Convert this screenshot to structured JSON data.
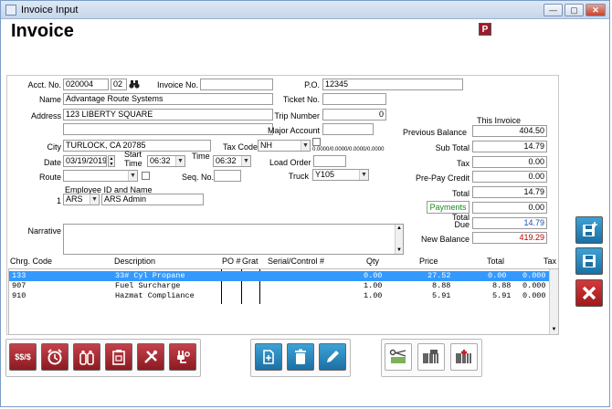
{
  "window": {
    "title": "Invoice Input",
    "min_label": "—",
    "max_label": "▢",
    "close_label": "✕"
  },
  "header": {
    "title": "Invoice",
    "badge": "P"
  },
  "form": {
    "acct_label": "Acct. No.",
    "acct_value": "020004",
    "acct_suffix": "02",
    "invoice_label": "Invoice No.",
    "invoice_value": "",
    "po_label": "P.O.",
    "po_value": "12345",
    "name_label": "Name",
    "name_value": "Advantage Route Systems",
    "ticket_label": "Ticket No.",
    "ticket_value": "",
    "address_label": "Address",
    "address_value": "123 LIBERTY SQUARE",
    "address2_value": "",
    "trip_label": "Trip Number",
    "trip_value": "0",
    "major_label": "Major Account",
    "major_value": "",
    "city_label": "City",
    "city_value": "TURLOCK, CA  20785",
    "taxcode_label": "Tax Code",
    "taxcode_value": "NH",
    "taxrates": "0.0000/0.0000/0.0000/0.0000",
    "date_label": "Date",
    "date_value": "03/19/2019",
    "start_time_label_1": "Start",
    "start_time_label_2": "Time",
    "start_time_value": "06:32",
    "time_label": "Time",
    "time_value": "06:32",
    "load_order_label": "Load Order",
    "load_order_value": "",
    "route_label": "Route",
    "route_value": "",
    "seq_label": "Seq. No.",
    "seq_value": "",
    "truck_label": "Truck",
    "truck_value": "Y105",
    "employee_label": "Employee ID and Name",
    "employee_index": "1",
    "employee_id": "ARS",
    "employee_name": "ARS Admin",
    "narrative_label": "Narrative",
    "narrative_value": ""
  },
  "totals": {
    "header": "This Invoice",
    "previous_balance_label": "Previous Balance",
    "previous_balance": "404.50",
    "subtotal_label": "Sub Total",
    "subtotal": "14.79",
    "tax_label": "Tax",
    "tax": "0.00",
    "prepay_label": "Pre-Pay Credit",
    "prepay": "0.00",
    "total_label": "Total",
    "total": "14.79",
    "payments_label": "Payments",
    "payments": "0.00",
    "total_due_label_1": "Total",
    "total_due_label_2": "Due",
    "total_due": "14.79",
    "new_balance_label": "New Balance",
    "new_balance": "419.29"
  },
  "grid": {
    "headers": {
      "code": "Chrg. Code",
      "desc": "Description",
      "po": "PO #",
      "grat": "Grat",
      "serial": "Serial/Control #",
      "qty": "Qty",
      "price": "Price",
      "total": "Total",
      "tax": "Tax"
    },
    "rows": [
      {
        "code": "133",
        "desc": "33# Cyl Propane",
        "qty": "0.00",
        "price": "27.52",
        "total": "0.00",
        "tax": "0.000"
      },
      {
        "code": "907",
        "desc": "Fuel Surcharge",
        "qty": "1.00",
        "price": "8.88",
        "total": "8.88",
        "tax": "0.000"
      },
      {
        "code": "910",
        "desc": "Hazmat Compliance",
        "qty": "1.00",
        "price": "5.91",
        "total": "5.91",
        "tax": "0.000"
      }
    ]
  },
  "toolbar": {
    "pricing_label": "$$/$"
  },
  "colors": {
    "accent_red": "#9b1c2c",
    "accent_blue": "#1c6fa3",
    "selection": "#3399ff",
    "payments_green": "#1a8a1a",
    "new_balance_red": "#c00000",
    "total_due_blue": "#1c4fb0"
  },
  "icons": [
    "binoculars-icon",
    "pricing-icon",
    "alarm-clock-icon",
    "cylinders-icon",
    "clipboard-icon",
    "tools-icon",
    "plug-icon",
    "new-document-icon",
    "delete-icon",
    "edit-icon",
    "scissors-money-icon",
    "barcode-scan-icon",
    "barcode-add-icon",
    "save-new-icon",
    "save-icon",
    "cancel-icon"
  ]
}
